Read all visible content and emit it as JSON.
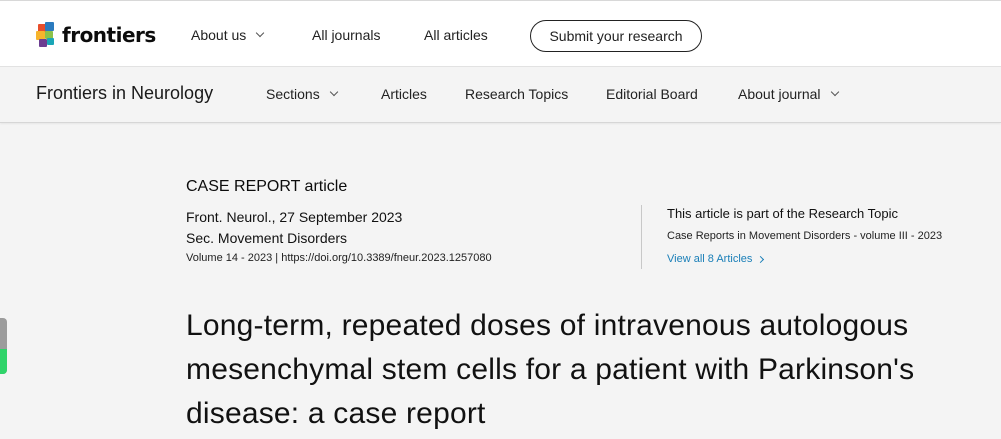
{
  "header": {
    "logo_text": "frontiers",
    "nav": {
      "about_us": "About us",
      "all_journals": "All journals",
      "all_articles": "All articles"
    },
    "submit_label": "Submit your research"
  },
  "journal_bar": {
    "title": "Frontiers in Neurology",
    "nav": {
      "sections": "Sections",
      "articles": "Articles",
      "research_topics": "Research Topics",
      "editorial_board": "Editorial Board",
      "about_journal": "About journal"
    }
  },
  "article": {
    "type": "CASE REPORT article",
    "citation": "Front. Neurol., 27 September 2023",
    "section": "Sec. Movement Disorders",
    "volume_doi": "Volume 14 - 2023 | https://doi.org/10.3389/fneur.2023.1257080",
    "title": "Long-term, repeated doses of intravenous autologous mesenchymal stem cells for a patient with Parkinson's disease: a case report"
  },
  "research_topic": {
    "label": "This article is part of the Research Topic",
    "name": "Case Reports in Movement Disorders - volume III - 2023",
    "view_all": "View all 8 Articles"
  },
  "colors": {
    "link": "#1a7fb8",
    "page_background": "#f4f4f4",
    "side_widget_fill": "#2fd46a"
  },
  "icons": [
    "frontiers-logo-icon",
    "chevron-down-icon",
    "chevron-right-icon"
  ]
}
